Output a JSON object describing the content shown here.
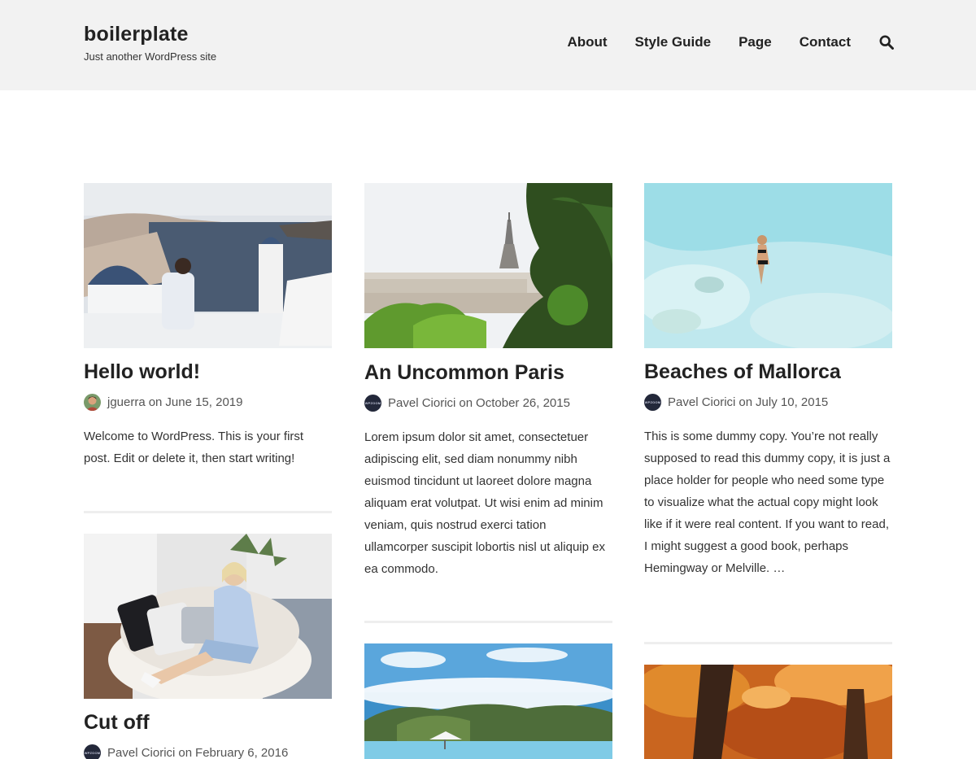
{
  "site": {
    "title": "boilerplate",
    "tagline": "Just another WordPress site"
  },
  "nav": {
    "items": [
      "About",
      "Style Guide",
      "Page",
      "Contact"
    ],
    "search_icon": "search-icon"
  },
  "posts": [
    {
      "title": "Hello world!",
      "author": "jguerra",
      "on": "on",
      "date": "June 15, 2019",
      "avatar": "photo",
      "excerpt": "Welcome to WordPress. This is your first post. Edit or delete it, then start writing!"
    },
    {
      "title": "An Uncommon Paris",
      "author": "Pavel Ciorici",
      "on": "on",
      "date": "October 26, 2015",
      "avatar": "logo",
      "excerpt": "Lorem ipsum dolor sit amet, consectetuer adipiscing elit, sed diam nonummy nibh euismod tincidunt ut laoreet dolore magna aliquam erat volutpat. Ut wisi enim ad minim veniam, quis nostrud exerci tation ullamcorper suscipit lobortis nisl ut aliquip ex ea commodo."
    },
    {
      "title": "Beaches of Mallorca",
      "author": "Pavel Ciorici",
      "on": "on",
      "date": "July 10, 2015",
      "avatar": "logo",
      "excerpt": "This is some dummy copy. You’re not really supposed to read this dummy copy, it is just a place holder for people who need some type to visualize what the actual copy might look like if it were real content. If you want to read, I might suggest a good book, perhaps Hemingway or Melville. …"
    },
    {
      "title": "Cut off",
      "author": "Pavel Ciorici",
      "on": "on",
      "date": "February 6, 2016",
      "avatar": "logo"
    }
  ],
  "avatar_logo_text": "WPZOOM",
  "colors": {
    "header_bg": "#f2f2f2",
    "text": "#222222",
    "meta": "#555555",
    "divider": "#eeeeee"
  }
}
